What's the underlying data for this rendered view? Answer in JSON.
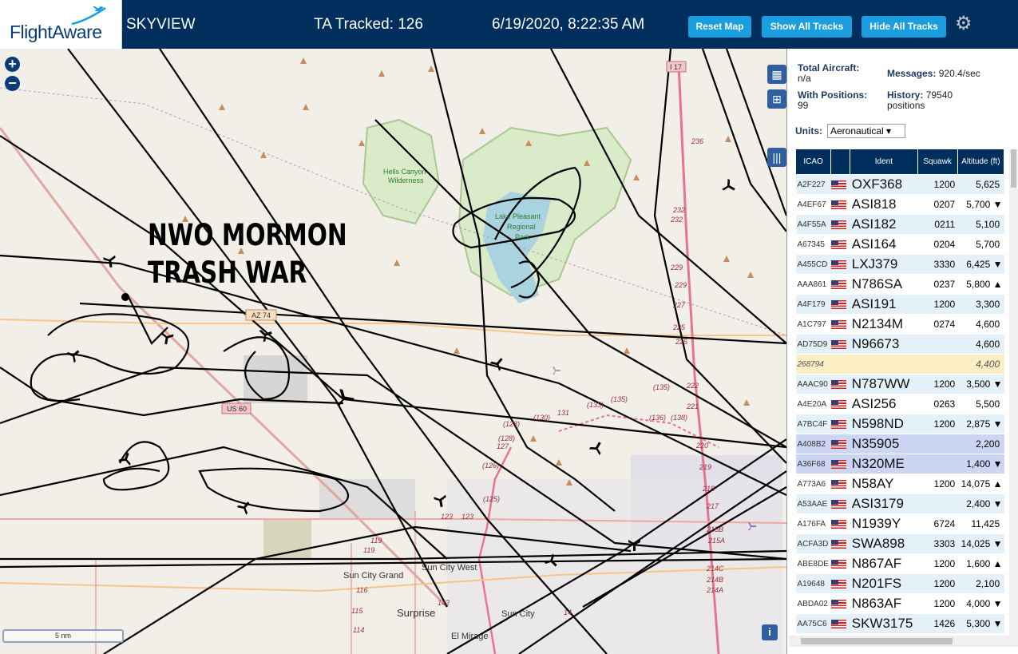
{
  "header": {
    "logo_text": "FlightAware",
    "app_title": "SKYVIEW",
    "tracked": "TA Tracked: 126",
    "datetime": "6/19/2020, 8:22:35 AM",
    "buttons": [
      "Reset Map",
      "Show All Tracks",
      "Hide All Tracks"
    ],
    "settings_icon": "gear-icon"
  },
  "map": {
    "zoom_in": "+",
    "zoom_out": "−",
    "annotation_line1": "NWO MORMON",
    "annotation_line2": "TRASH WAR",
    "scale": "5 nm",
    "info": "i",
    "labels": {
      "hells1": "Hells Canyon",
      "hells2": "Wilderness",
      "lake1": "Lake Pleasant",
      "lake2": "Regional",
      "lake3": "Park",
      "suncitygrand": "Sun City Grand",
      "suncitywest": "Sun City West",
      "surprise": "Surprise",
      "suncity": "Sun City",
      "elmirage": "El Mirage",
      "az74": "AZ 74",
      "us60": "US 60",
      "i17": "I 17"
    },
    "mile_markers": [
      "236",
      "232",
      "232",
      "229",
      "229",
      "227",
      "225",
      "225",
      "222",
      "221",
      "220",
      "219",
      "218",
      "217",
      "215B",
      "215A",
      "214C",
      "214B",
      "214A",
      "233",
      "135",
      "136",
      "138",
      "130",
      "128",
      "127",
      "126",
      "123",
      "123",
      "123",
      "119",
      "119",
      "116",
      "115",
      "114",
      "142",
      "140",
      "131",
      "128",
      "14",
      "135",
      "125",
      "119"
    ]
  },
  "panel": {
    "total_aircraft_label": "Total Aircraft:",
    "total_aircraft_value": "n/a",
    "messages_label": "Messages:",
    "messages_value": "920.4/sec",
    "with_positions_label": "With Positions:",
    "with_positions_value": "99",
    "history_label": "History:",
    "history_value": "79540",
    "history_unit": "positions",
    "units_label": "Units:",
    "units_value": "Aeronautical ▾",
    "columns": [
      "ICAO",
      "Ident",
      "Squawk",
      "Altitude (ft)"
    ],
    "rows": [
      {
        "icao": "A2F227",
        "ident": "OXF368",
        "squawk": "1200",
        "alt": "5,625",
        "trend": ""
      },
      {
        "icao": "A4EF67",
        "ident": "ASI818",
        "squawk": "0207",
        "alt": "5,700",
        "trend": "▼"
      },
      {
        "icao": "A4F55A",
        "ident": "ASI182",
        "squawk": "0211",
        "alt": "5,100",
        "trend": ""
      },
      {
        "icao": "A67345",
        "ident": "ASI164",
        "squawk": "0204",
        "alt": "5,700",
        "trend": ""
      },
      {
        "icao": "A455CD",
        "ident": "LXJ379",
        "squawk": "3330",
        "alt": "6,425",
        "trend": "▼"
      },
      {
        "icao": "AAA861",
        "ident": "N786SA",
        "squawk": "0237",
        "alt": "5,800",
        "trend": "▲"
      },
      {
        "icao": "A4F179",
        "ident": "ASI191",
        "squawk": "1200",
        "alt": "3,300",
        "trend": ""
      },
      {
        "icao": "A1C797",
        "ident": "N2134M",
        "squawk": "0274",
        "alt": "4,600",
        "trend": ""
      },
      {
        "icao": "AD75D9",
        "ident": "N96673",
        "squawk": "",
        "alt": "4,600",
        "trend": ""
      },
      {
        "icao": "268794",
        "ident": "",
        "squawk": "",
        "alt": "4,400",
        "trend": "",
        "nopos": true
      },
      {
        "icao": "AAAC90",
        "ident": "N787WW",
        "squawk": "1200",
        "alt": "3,500",
        "trend": "▼"
      },
      {
        "icao": "A4E20A",
        "ident": "ASI256",
        "squawk": "0263",
        "alt": "5,500",
        "trend": ""
      },
      {
        "icao": "A7BC4F",
        "ident": "N598ND",
        "squawk": "1200",
        "alt": "2,875",
        "trend": "▼"
      },
      {
        "icao": "A408B2",
        "ident": "N35905",
        "squawk": "",
        "alt": "2,200",
        "trend": "",
        "sel": true
      },
      {
        "icao": "A36F68",
        "ident": "N320ME",
        "squawk": "",
        "alt": "1,400",
        "trend": "▼",
        "sel": true
      },
      {
        "icao": "A773A6",
        "ident": "N58AY",
        "squawk": "1200",
        "alt": "14,075",
        "trend": "▲"
      },
      {
        "icao": "A53AAE",
        "ident": "ASI3179",
        "squawk": "",
        "alt": "2,400",
        "trend": "▼"
      },
      {
        "icao": "A176FA",
        "ident": "N1939Y",
        "squawk": "6724",
        "alt": "11,425",
        "trend": ""
      },
      {
        "icao": "ACFA3D",
        "ident": "SWA898",
        "squawk": "3303",
        "alt": "14,025",
        "trend": "▼"
      },
      {
        "icao": "ABE8DE",
        "ident": "N867AF",
        "squawk": "1200",
        "alt": "1,600",
        "trend": "▲"
      },
      {
        "icao": "A19648",
        "ident": "N201FS",
        "squawk": "1200",
        "alt": "2,100",
        "trend": ""
      },
      {
        "icao": "ABDA02",
        "ident": "N863AF",
        "squawk": "1200",
        "alt": "4,000",
        "trend": "▼"
      },
      {
        "icao": "AA75C6",
        "ident": "SKW3175",
        "squawk": "1426",
        "alt": "5,300",
        "trend": "▼"
      }
    ]
  }
}
